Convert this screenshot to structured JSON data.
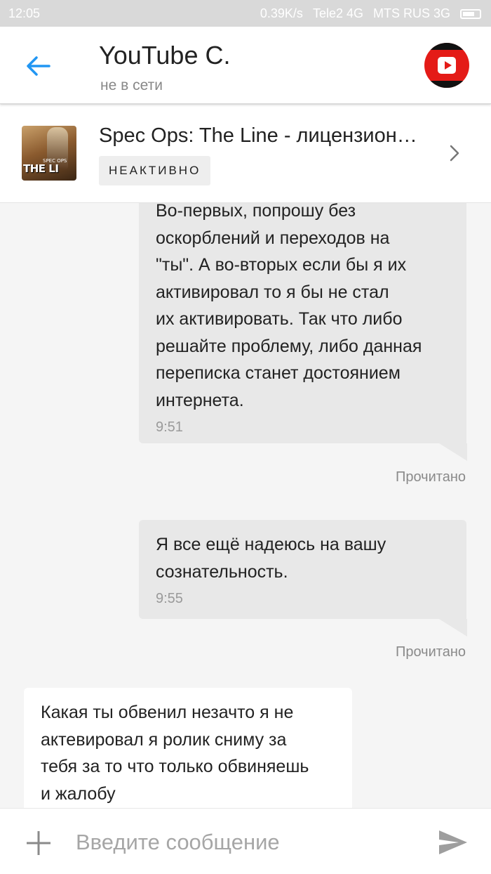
{
  "status_bar": {
    "time": "12:05",
    "speed": "0.39K/s",
    "carrier1": "Tele2 4G",
    "carrier2": "MTS RUS 3G"
  },
  "header": {
    "title": "YouTube C.",
    "status": "не в сети",
    "avatar_icon": "youtube-logo-icon"
  },
  "product": {
    "title": "Spec Ops: The Line - лицензион…",
    "badge": "НЕАКТИВНО",
    "thumb_text": "THE LI",
    "thumb_small_text": "SPEC OPS"
  },
  "messages": [
    {
      "direction": "out",
      "text": "Во-первых, попрошу без\nоскорблений и переходов на\n\"ты\". А во-вторых если бы я их\nактивировал то я бы не стал\nих активировать. Так что либо\nрешайте проблему, либо данная\nпереписка станет достоянием\nинтернета.",
      "time": "9:51",
      "receipt": "Прочитано"
    },
    {
      "direction": "out",
      "text": "Я все ещё надеюсь на вашу\nсознательность.",
      "time": "9:55",
      "receipt": "Прочитано"
    },
    {
      "direction": "in",
      "text": "Какая ты обвенил незачто я не\nактевировал я ролик сниму за\nтебя за то что только обвиняешь\nи жалобу"
    }
  ],
  "composer": {
    "placeholder": "Введите сообщение"
  },
  "colors": {
    "accent": "#2196f3",
    "outgoing_bubble": "#e8e8e8",
    "incoming_bubble": "#ffffff",
    "avatar_red": "#e41b17"
  }
}
